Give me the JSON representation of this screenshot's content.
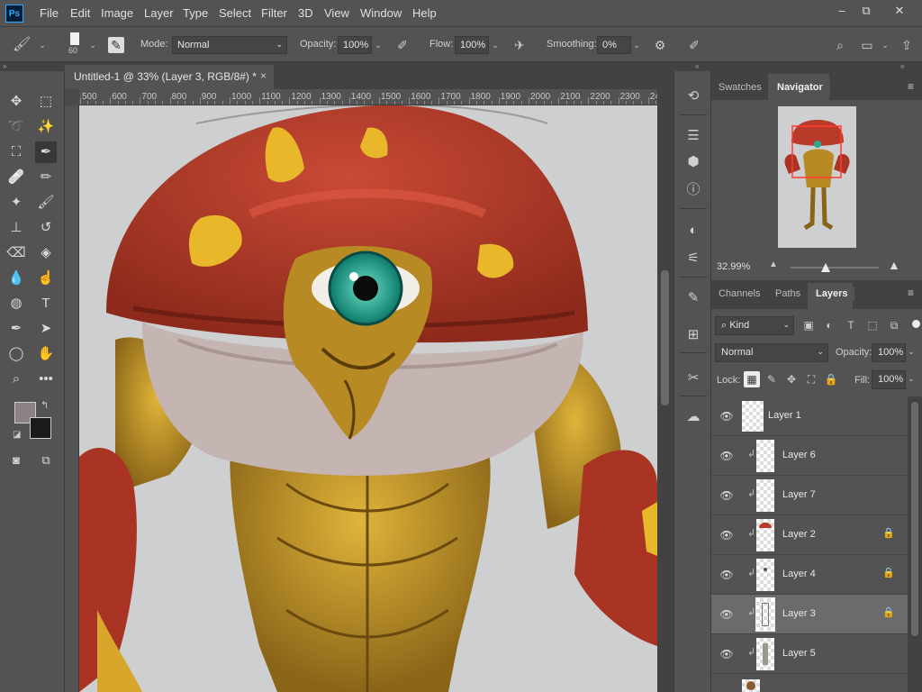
{
  "app": {
    "logo_text": "Ps"
  },
  "menu": [
    "File",
    "Edit",
    "Image",
    "Layer",
    "Type",
    "Select",
    "Filter",
    "3D",
    "View",
    "Window",
    "Help"
  ],
  "window_controls": {
    "minimize": "–",
    "restore": "⧉",
    "close": "✕"
  },
  "options_bar": {
    "brush_size": "60",
    "mode_label": "Mode:",
    "mode_value": "Normal",
    "opacity_label": "Opacity:",
    "opacity_value": "100%",
    "flow_label": "Flow:",
    "flow_value": "100%",
    "smoothing_label": "Smoothing:",
    "smoothing_value": "0%"
  },
  "collapse_glyph": "«",
  "expand_glyph": "»",
  "document": {
    "tab_title": "Untitled-1 @ 33% (Layer 3, RGB/8#) *",
    "close_glyph": "×"
  },
  "ruler_labels": [
    "500",
    "600",
    "700",
    "800",
    "900",
    "1000",
    "1100",
    "1200",
    "1300",
    "1400",
    "1500",
    "1600",
    "1700",
    "1800",
    "1900",
    "2000",
    "2100",
    "2200",
    "2300",
    "24"
  ],
  "navigator_panel": {
    "tabs": [
      "Swatches",
      "Navigator"
    ],
    "active_tab": "Navigator",
    "zoom": "32.99%",
    "menu_glyph": "≡"
  },
  "layers_panel": {
    "tabs": [
      "Channels",
      "Paths",
      "Layers"
    ],
    "active_tab": "Layers",
    "filter_kind": "Kind",
    "blend_mode": "Normal",
    "opacity_label": "Opacity:",
    "opacity_value": "100%",
    "lock_label": "Lock:",
    "fill_label": "Fill:",
    "fill_value": "100%",
    "menu_glyph": "≡",
    "layers": [
      {
        "name": "Layer 1",
        "clipped": false,
        "locked": false,
        "selected": false
      },
      {
        "name": "Layer 6",
        "clipped": true,
        "locked": false,
        "selected": false
      },
      {
        "name": "Layer 7",
        "clipped": true,
        "locked": false,
        "selected": false
      },
      {
        "name": "Layer 2",
        "clipped": true,
        "locked": true,
        "selected": false
      },
      {
        "name": "Layer 4",
        "clipped": true,
        "locked": true,
        "selected": false
      },
      {
        "name": "Layer 3",
        "clipped": true,
        "locked": true,
        "selected": true
      },
      {
        "name": "Layer 5",
        "clipped": true,
        "locked": false,
        "selected": false
      }
    ]
  },
  "colors": {
    "foreground": "#8c8283",
    "background": "#1a1a1a",
    "accent": "#31a8ff"
  }
}
